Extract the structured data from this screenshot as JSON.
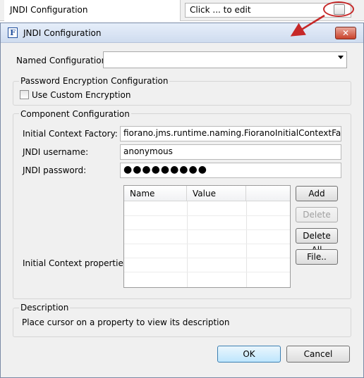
{
  "property_row": {
    "name": "JNDI Configuration",
    "value": "Click ... to edit"
  },
  "dialog": {
    "title": "JNDI Configuration",
    "app_icon_letter": "F",
    "close_glyph": "✕",
    "named_configuration": {
      "label": "Named Configuration",
      "value": ""
    },
    "password_encryption": {
      "title": "Password Encryption Configuration",
      "use_custom_encryption": {
        "label": "Use Custom Encryption",
        "checked": false
      }
    },
    "component_configuration": {
      "title": "Component Configuration",
      "initial_context_factory": {
        "label": "Initial Context Factory:",
        "value": "fiorano.jms.runtime.naming.FioranoInitialContextFactory"
      },
      "jndi_username": {
        "label": "JNDI username:",
        "value": "anonymous"
      },
      "jndi_password": {
        "label": "JNDI password:",
        "value": "●●●●●●●●●"
      },
      "initial_context_properties": {
        "label": "Initial Context properties:",
        "columns": [
          "Name",
          "Value",
          ""
        ],
        "rows": []
      },
      "buttons": {
        "add": "Add",
        "delete": "Delete",
        "delete_all": "Delete All",
        "file": "File.."
      }
    },
    "description": {
      "title": "Description",
      "text": "Place cursor on a property to view its description"
    },
    "footer": {
      "ok": "OK",
      "cancel": "Cancel"
    }
  },
  "colors": {
    "annotation": "#c62828",
    "title_bar": "#d6e3f5"
  }
}
